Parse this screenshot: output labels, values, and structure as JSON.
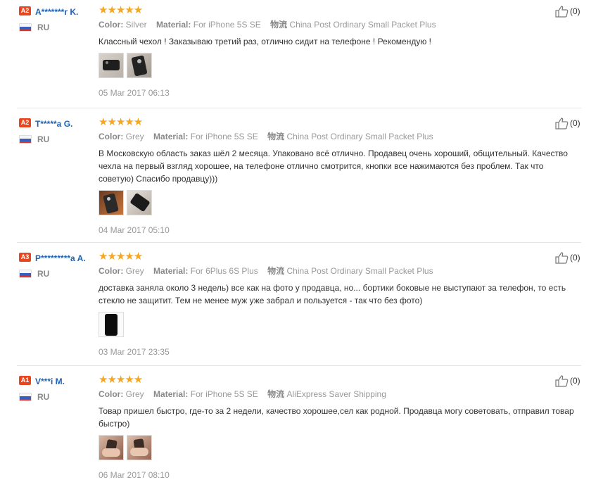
{
  "reviews": [
    {
      "level": "A2",
      "name": "A*******r K.",
      "country": "RU",
      "stars": "★★★★★",
      "color_label": "Color:",
      "color": "Silver",
      "material_label": "Material:",
      "material": "For iPhone 5S SE",
      "shipping_label": "物流",
      "shipping": "China Post Ordinary Small Packet Plus",
      "text": "Классный чехол ! Заказываю третий раз, отлично сидит на телефоне ! Рекомендую !",
      "date": "05 Mar 2017 06:13",
      "likes": "(0)"
    },
    {
      "level": "A2",
      "name": "T*****a G.",
      "country": "RU",
      "stars": "★★★★★",
      "color_label": "Color:",
      "color": "Grey",
      "material_label": "Material:",
      "material": "For iPhone 5S SE",
      "shipping_label": "物流",
      "shipping": "China Post Ordinary Small Packet Plus",
      "text": "В Московскую область заказ шёл 2 месяца. Упаковано всё отлично. Продавец очень хороший, общительный. Качество чехла на первый взгляд хорошее, на телефоне отлично смотрится, кнопки все нажимаются без проблем. Так что советую) Спасибо продавцу)))",
      "date": "04 Mar 2017 05:10",
      "likes": "(0)"
    },
    {
      "level": "A3",
      "name": "P*********a A.",
      "country": "RU",
      "stars": "★★★★★",
      "color_label": "Color:",
      "color": "Grey",
      "material_label": "Material:",
      "material": "For 6Plus 6S Plus",
      "shipping_label": "物流",
      "shipping": "China Post Ordinary Small Packet Plus",
      "text": "доставка заняла около 3 недель) все как на фото у продавца, но... бортики боковые не выступают за телефон, то есть стекло не защитит. Тем не менее муж уже забрал и пользуется - так что без фото)",
      "date": "03 Mar 2017 23:35",
      "likes": "(0)"
    },
    {
      "level": "A1",
      "name": "V***i M.",
      "country": "RU",
      "stars": "★★★★★",
      "color_label": "Color:",
      "color": "Grey",
      "material_label": "Material:",
      "material": "For iPhone 5S SE",
      "shipping_label": "物流",
      "shipping": "AliExpress Saver Shipping",
      "text": "Товар пришел быстро, где-то за 2 недели, качество хорошее,сел как родной. Продавца могу советовать, отправил товар быстро)",
      "date": "06 Mar 2017 08:10",
      "likes": "(0)"
    }
  ],
  "colors": {
    "star": "#f5a623",
    "buyer_link": "#1f63b5",
    "level_badge": "#e8461e"
  }
}
